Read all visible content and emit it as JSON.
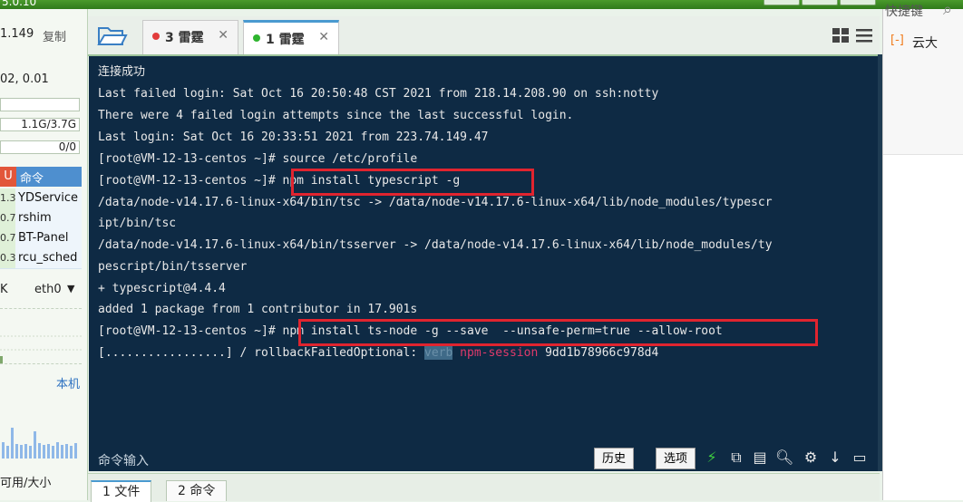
{
  "app": {
    "version": "5.0.10"
  },
  "left_panel": {
    "ip_suffix": "1.149",
    "copy_label": "复制",
    "load": "02, 0.01",
    "mem": "1.1G/3.7G",
    "swap": "0/0",
    "proc_header_col": "U",
    "proc_header": "命令",
    "processes": [
      {
        "v": "1.3",
        "name": "YDService"
      },
      {
        "v": "0.7",
        "name": "rshim"
      },
      {
        "v": "0.7",
        "name": "BT-Panel"
      },
      {
        "v": "0.3",
        "name": "rcu_sched"
      }
    ],
    "net_unit": "K",
    "net_iface": "eth0",
    "local_label": "本机",
    "disk_label": "可用/大小"
  },
  "tabs": [
    {
      "label": "3 雷霆",
      "dot": "#e23b3b",
      "active": false
    },
    {
      "label": "1 雷霆",
      "dot": "#2fb52f",
      "active": true
    }
  ],
  "terminal": {
    "lines": [
      "连接成功",
      "Last failed login: Sat Oct 16 20:50:48 CST 2021 from 218.14.208.90 on ssh:notty",
      "There were 4 failed login attempts since the last successful login.",
      "Last login: Sat Oct 16 20:33:51 2021 from 223.74.149.47",
      "[root@VM-12-13-centos ~]# source /etc/profile",
      "[root@VM-12-13-centos ~]# npm install typescript -g",
      "/data/node-v14.17.6-linux-x64/bin/tsc -> /data/node-v14.17.6-linux-x64/lib/node_modules/typescr",
      "ipt/bin/tsc",
      "/data/node-v14.17.6-linux-x64/bin/tsserver -> /data/node-v14.17.6-linux-x64/lib/node_modules/ty",
      "pescript/bin/tsserver",
      "+ typescript@4.4.4",
      "added 1 package from 1 contributor in 17.901s",
      "[root@VM-12-13-centos ~]# npm install ts-node -g --save  --unsafe-perm=true --allow-root"
    ],
    "progress_prefix": "[.................] / rollbackFailedOptional: ",
    "progress_warn": "verb",
    "progress_session": "npm-session",
    "progress_id": " 9dd1b78966c978d4"
  },
  "cmd": {
    "label": "命令输入",
    "history": "历史",
    "options": "选项"
  },
  "bottom_tabs": [
    "1 文件",
    "2 命令"
  ],
  "right_panel": {
    "top_text": "快捷键",
    "item": "云大"
  }
}
